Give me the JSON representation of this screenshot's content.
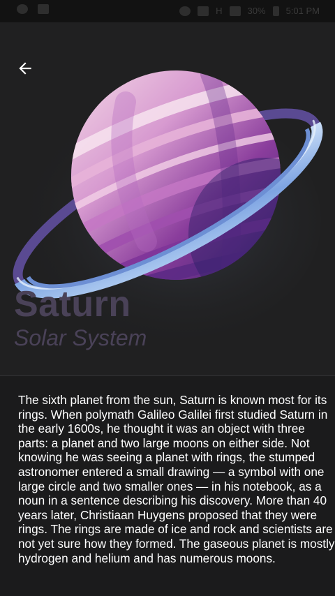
{
  "status_bar": {
    "network_label": "H",
    "battery_percent": "30%",
    "time": "5:01 PM"
  },
  "header": {
    "title": "Saturn",
    "subtitle": "Solar System",
    "back_icon": "arrow-left-icon"
  },
  "content": {
    "description": "The sixth planet from the sun, Saturn is known most for its rings. When polymath Galileo Galilei first studied Saturn in the early 1600s, he thought it was an object with three parts: a planet and two large moons on either side. Not knowing he was seeing a planet with rings, the stumped astronomer entered a small drawing — a symbol with one large circle and two smaller ones — in his notebook, as a noun in a sentence describing his discovery. More than 40 years later, Christiaan Huygens proposed that they were rings. The rings are made of ice and rock and scientists are not yet sure how they formed. The gaseous planet is mostly hydrogen and helium and has numerous moons."
  },
  "colors": {
    "background": "#1b1b1c",
    "title_color": "#4a4258",
    "planet_purple": "#6a2e8c",
    "ring_blue": "#8fb4e8"
  }
}
